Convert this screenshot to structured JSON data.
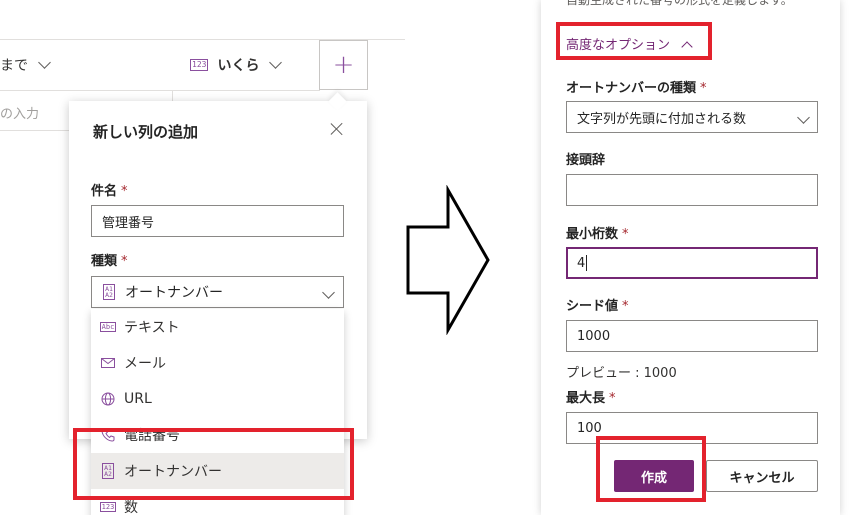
{
  "left": {
    "column_headers": {
      "until_partial": "まで",
      "amount": "いくら",
      "amount_icon": "number-icon"
    },
    "grid_placeholder": "の入力",
    "add_column_symbol": "+",
    "dialog": {
      "title": "新しい列の追加",
      "name_label": "件名",
      "name_value": "管理番号",
      "type_label": "種類",
      "type_value": "オートナンバー",
      "required_mark": "*",
      "menu_items": [
        {
          "label": "テキスト",
          "icon": "text-abc-icon"
        },
        {
          "label": "メール",
          "icon": "mail-icon"
        },
        {
          "label": "URL",
          "icon": "globe-icon"
        },
        {
          "label": "電話番号",
          "icon": "phone-icon"
        },
        {
          "label": "オートナンバー",
          "icon": "autonumber-icon"
        },
        {
          "label": "数",
          "icon": "number-icon"
        }
      ]
    }
  },
  "arrow": {
    "direction": "right"
  },
  "right": {
    "top_partial_text": "自動生成された番号の形式を定義します。",
    "advanced_options": "高度なオプション",
    "autonumber_type_label": "オートナンバーの種類",
    "autonumber_type_value": "文字列が先頭に付加される数",
    "prefix_label": "接頭辞",
    "prefix_value": "",
    "min_digits_label": "最小桁数",
    "min_digits_value": "4",
    "seed_label": "シード値",
    "seed_value": "1000",
    "preview_text": "プレビュー : 1000",
    "max_length_label": "最大長",
    "max_length_value": "100",
    "create_button": "作成",
    "cancel_button": "キャンセル",
    "required_mark": "*"
  },
  "colors": {
    "accent": "#742774",
    "highlight_box": "#e3222d",
    "required": "#a4262c"
  }
}
